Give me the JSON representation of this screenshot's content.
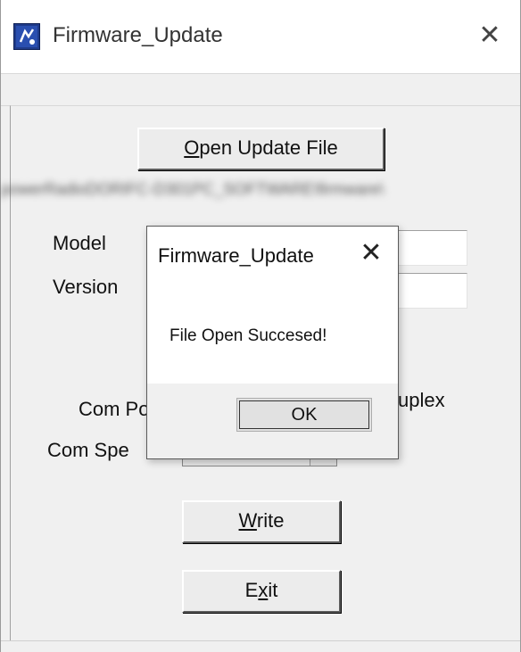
{
  "window": {
    "title": "Firmware_Update",
    "close_glyph": "✕",
    "icon": "app-icon"
  },
  "main": {
    "open_button": {
      "pre": "",
      "mnemonic": "O",
      "post": "pen Update File"
    },
    "file_path": "powerRadioDORIFC-D301PC_SOFTWARE\\firmware\\",
    "model_label": "Model",
    "version_label": "Version",
    "com_port_label": "Com Po",
    "com_speed_label": "Com Spe",
    "duplex_label": "uplex",
    "write_button": {
      "pre": "",
      "mnemonic": "W",
      "post": "rite"
    },
    "exit_button": {
      "pre": "E",
      "mnemonic": "x",
      "post": "it"
    }
  },
  "dialog": {
    "title": "Firmware_Update",
    "close_glyph": "✕",
    "message": "File Open Succesed!",
    "ok_label": "OK"
  },
  "colors": {
    "app_icon": "#1f3b8a",
    "window_bg": "#f0f0f0",
    "dialog_bg": "#ffffff"
  }
}
